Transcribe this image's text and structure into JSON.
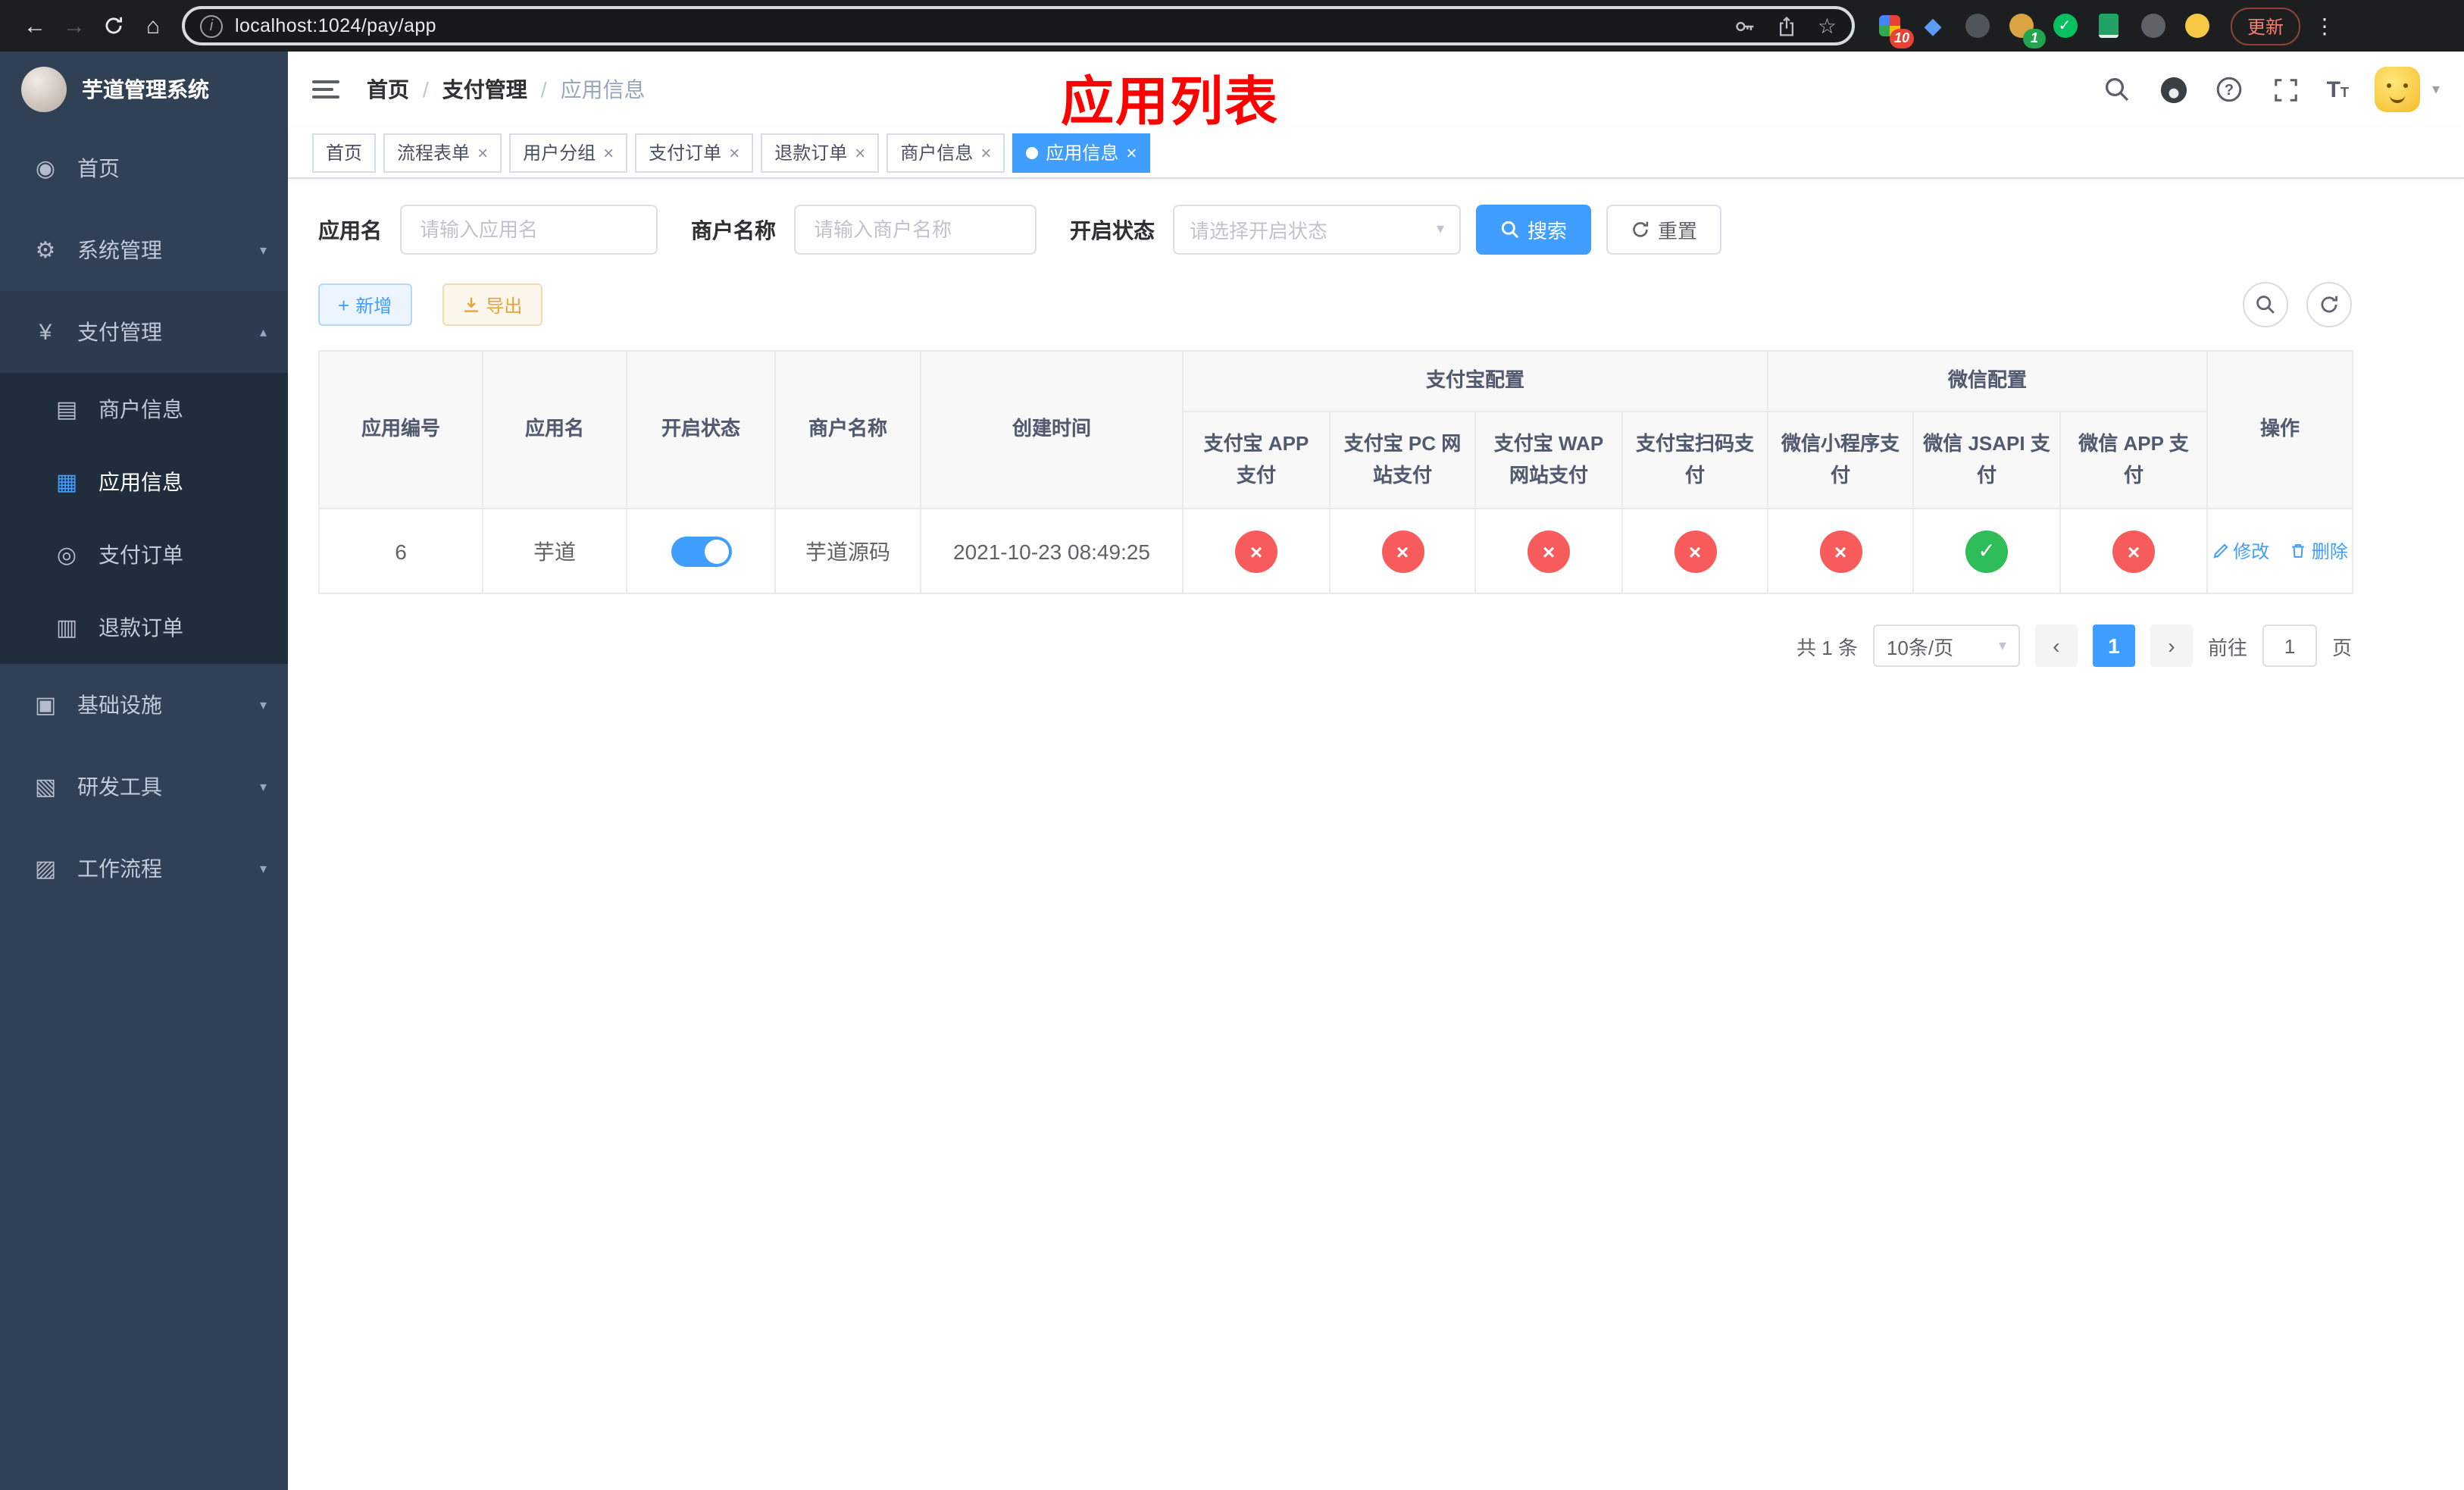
{
  "browser": {
    "url": "localhost:1024/pay/app",
    "update_label": "更新",
    "ext_badge_red": "10",
    "ext_badge_green": "1"
  },
  "icons": {
    "back": "←",
    "forward": "→",
    "home": "⌂",
    "more": "⋮",
    "star": "☆",
    "info": "i",
    "close": "×",
    "chevron_down": "▾",
    "chevron_up": "▴",
    "caret_down": "▾",
    "prev": "‹",
    "next": "›",
    "plus": "+",
    "check": "✓",
    "cross": "×",
    "diamond": "◆",
    "font_big": "T",
    "font_small": "T"
  },
  "sidebar": {
    "logo_title": "芋道管理系统",
    "menu": [
      {
        "label": "首页",
        "glyph": "◉"
      },
      {
        "label": "系统管理",
        "glyph": "⚙"
      },
      {
        "label": "支付管理",
        "glyph": "¥"
      },
      {
        "label": "基础设施",
        "glyph": "▣"
      },
      {
        "label": "研发工具",
        "glyph": "▧"
      },
      {
        "label": "工作流程",
        "glyph": "▨"
      }
    ],
    "pay_submenu": [
      {
        "label": "商户信息",
        "glyph": "▤"
      },
      {
        "label": "应用信息",
        "glyph": "▦"
      },
      {
        "label": "支付订单",
        "glyph": "◎"
      },
      {
        "label": "退款订单",
        "glyph": "▥"
      }
    ]
  },
  "navbar": {
    "breadcrumb": [
      "首页",
      "支付管理",
      "应用信息"
    ],
    "separator": "/",
    "annotation": "应用列表"
  },
  "tabs": [
    {
      "label": "首页"
    },
    {
      "label": "流程表单"
    },
    {
      "label": "用户分组"
    },
    {
      "label": "支付订单"
    },
    {
      "label": "退款订单"
    },
    {
      "label": "商户信息"
    },
    {
      "label": "应用信息"
    }
  ],
  "filters": {
    "app_name_label": "应用名",
    "app_name_placeholder": "请输入应用名",
    "merchant_label": "商户名称",
    "merchant_placeholder": "请输入商户名称",
    "status_label": "开启状态",
    "status_placeholder": "请选择开启状态",
    "search_label": "搜索",
    "reset_label": "重置"
  },
  "toolbar": {
    "add_label": "新增",
    "export_label": "导出"
  },
  "table": {
    "col_app_id": "应用编号",
    "col_app_name": "应用名",
    "col_status": "开启状态",
    "col_merchant": "商户名称",
    "col_created": "创建时间",
    "group_alipay": "支付宝配置",
    "group_wechat": "微信配置",
    "col_alipay_app": "支付宝 APP 支付",
    "col_alipay_pc": "支付宝 PC 网站支付",
    "col_alipay_wap": "支付宝 WAP 网站支付",
    "col_alipay_qr": "支付宝扫码支付",
    "col_wx_lite": "微信小程序支付",
    "col_wx_jsapi": "微信 JSAPI 支付",
    "col_wx_app": "微信 APP 支付",
    "col_actions": "操作",
    "row": {
      "app_id": "6",
      "app_name": "芋道",
      "enabled": true,
      "merchant": "芋道源码",
      "created": "2021-10-23 08:49:25",
      "alipay_app": false,
      "alipay_pc": false,
      "alipay_wap": false,
      "alipay_qr": false,
      "wx_lite": false,
      "wx_jsapi": true,
      "wx_app": false,
      "edit_label": "修改",
      "delete_label": "删除"
    }
  },
  "pagination": {
    "total_text": "共 1 条",
    "page_size": "10条/页",
    "current_page": "1",
    "goto_label": "前往",
    "goto_value": "1",
    "page_unit": "页"
  },
  "colors": {
    "accent": "#409eff",
    "status_yes": "#2ebd59",
    "status_no": "#f75b5b",
    "annotation": "#ff0000",
    "sidebar_bg": "#304156",
    "submenu_bg": "#1f2d3d"
  }
}
